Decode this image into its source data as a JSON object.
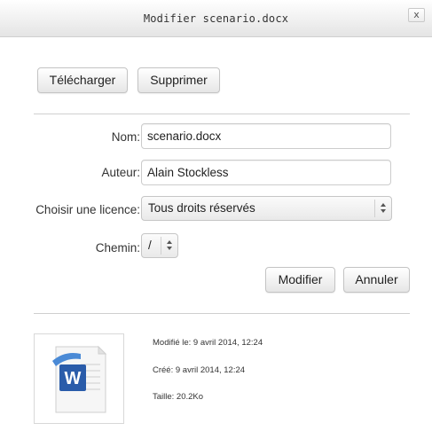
{
  "dialog": {
    "title": "Modifier scenario.docx",
    "close_label": "x"
  },
  "actions": {
    "download_label": "Télécharger",
    "delete_label": "Supprimer"
  },
  "form": {
    "name_label": "Nom:",
    "name_value": "scenario.docx",
    "author_label": "Auteur:",
    "author_value": "Alain Stockless",
    "license_label": "Choisir une licence:",
    "license_value": "Tous droits réservés",
    "path_label": "Chemin:",
    "path_value": "/",
    "submit_label": "Modifier",
    "cancel_label": "Annuler"
  },
  "file_info": {
    "icon": "word-document-icon",
    "modified": "Modifié le: 9 avril 2014, 12:24",
    "created": "Créé: 9 avril 2014, 12:24",
    "size": "Taille: 20.2Ko"
  },
  "colors": {
    "word_blue": "#2a5caa",
    "word_blue_light": "#4a8ad6"
  }
}
